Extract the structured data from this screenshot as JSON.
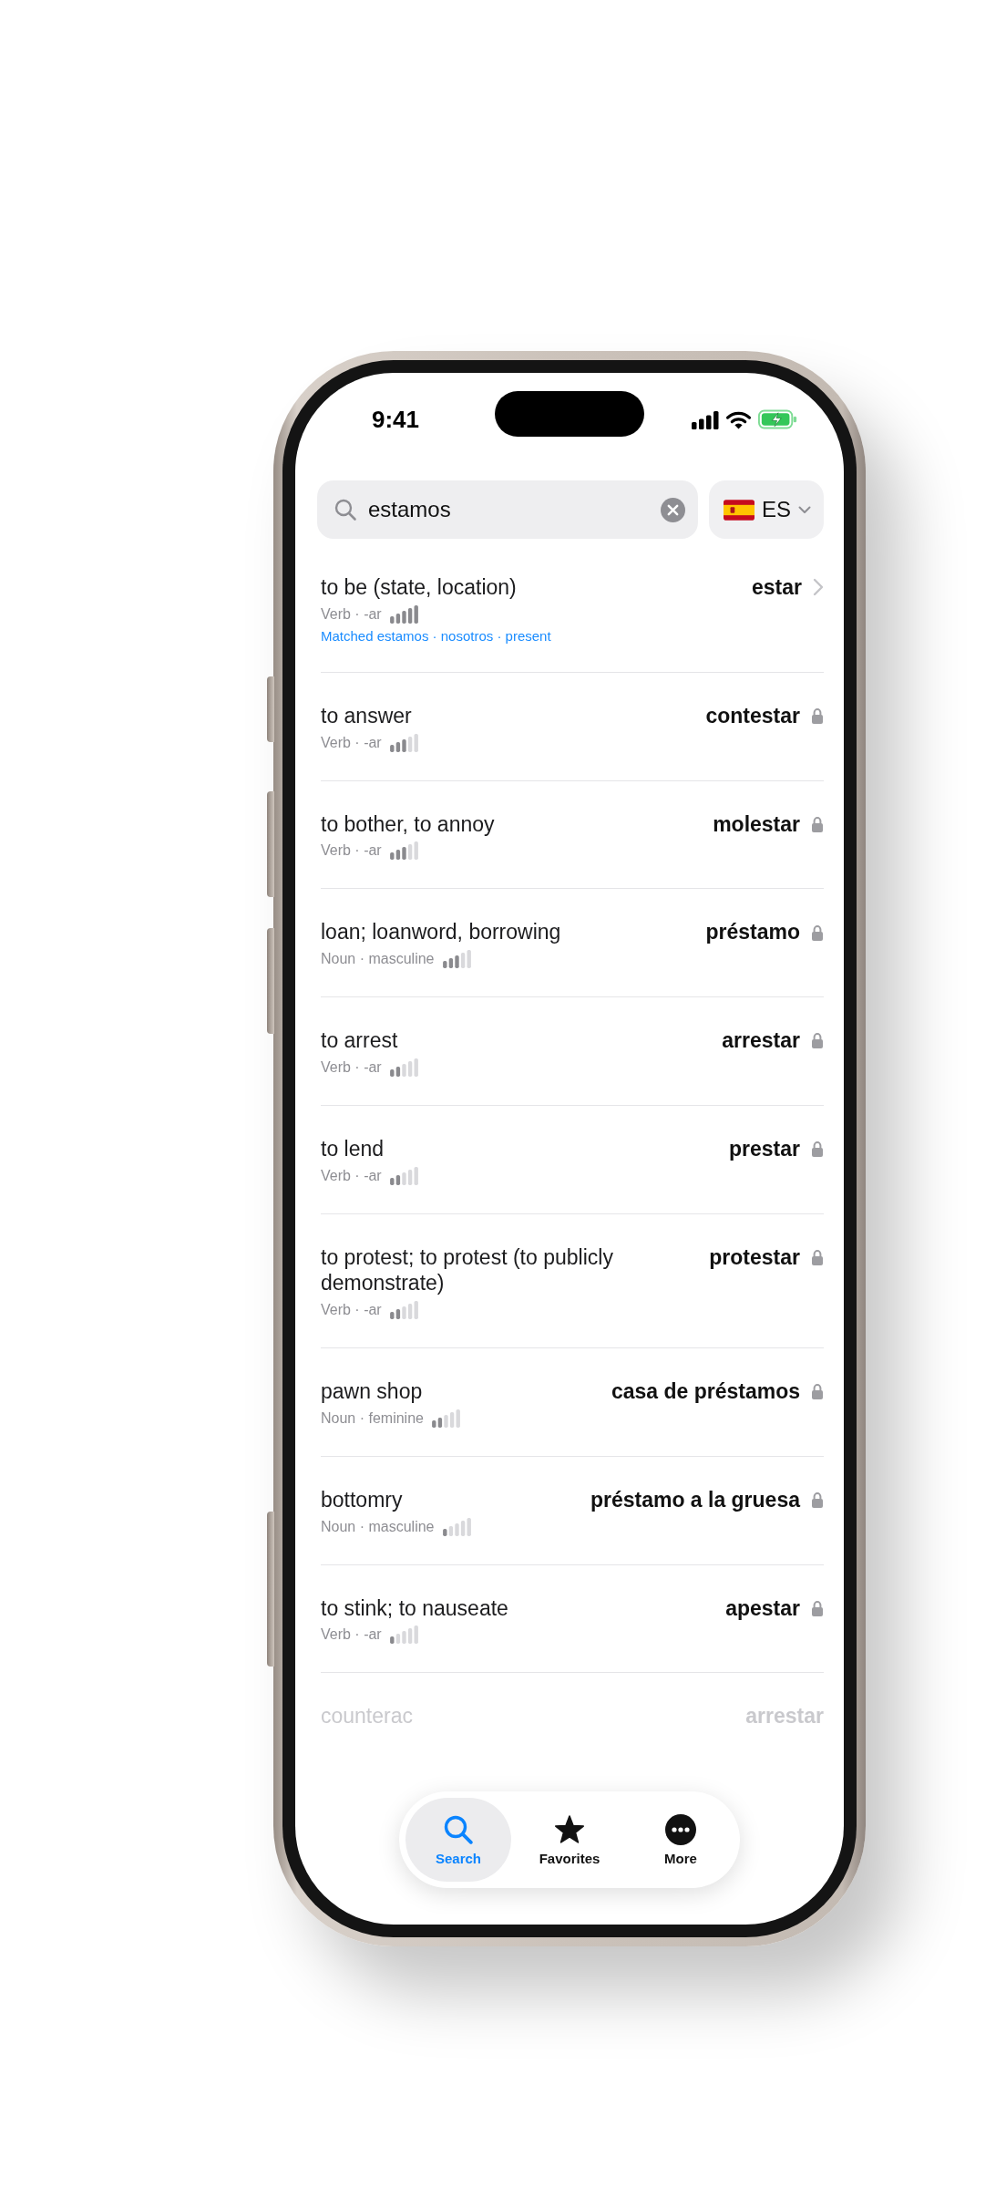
{
  "status_bar": {
    "time": "9:41"
  },
  "search_field": {
    "value": "estamos"
  },
  "language_button": {
    "label": "ES"
  },
  "results": [
    {
      "gloss": "to be (state, location)",
      "headword": "estar",
      "meta": "Verb · -ar",
      "level": 1,
      "match": "Matched estamos · nosotros · present",
      "locked": false,
      "faded": false
    },
    {
      "gloss": "to answer",
      "headword": "contestar",
      "meta": "Verb · -ar",
      "level": 0.6,
      "locked": true,
      "faded": false
    },
    {
      "gloss": "to bother, to annoy",
      "headword": "molestar",
      "meta": "Verb · -ar",
      "level": 0.6,
      "locked": true,
      "faded": false
    },
    {
      "gloss": "loan; loanword, borrowing",
      "headword": "préstamo",
      "meta": "Noun · masculine",
      "level": 0.6,
      "locked": true,
      "faded": false
    },
    {
      "gloss": "to arrest",
      "headword": "arrestar",
      "meta": "Verb · -ar",
      "level": 0.4,
      "locked": true,
      "faded": false
    },
    {
      "gloss": "to lend",
      "headword": "prestar",
      "meta": "Verb · -ar",
      "level": 0.4,
      "locked": true,
      "faded": false
    },
    {
      "gloss": "to protest; to protest (to publicly demonstrate)",
      "headword": "protestar",
      "meta": "Verb · -ar",
      "level": 0.4,
      "locked": true,
      "faded": false
    },
    {
      "gloss": "pawn shop",
      "headword": "casa de préstamos",
      "meta": "Noun · feminine",
      "level": 0.4,
      "locked": true,
      "faded": false
    },
    {
      "gloss": "bottomry",
      "headword": "préstamo a la gruesa",
      "meta": "Noun · masculine",
      "level": 0.2,
      "locked": true,
      "faded": false
    },
    {
      "gloss": "to stink; to nauseate",
      "headword": "apestar",
      "meta": "Verb · -ar",
      "level": 0.2,
      "locked": true,
      "faded": false
    },
    {
      "gloss": "counterac",
      "headword": "arrestar",
      "faded": true
    }
  ],
  "tab_bar": {
    "tabs": [
      {
        "label": "Search",
        "kind": "search",
        "selected": true
      },
      {
        "label": "Favorites",
        "kind": "star",
        "selected": false
      },
      {
        "label": "More",
        "kind": "more",
        "selected": false
      }
    ]
  }
}
